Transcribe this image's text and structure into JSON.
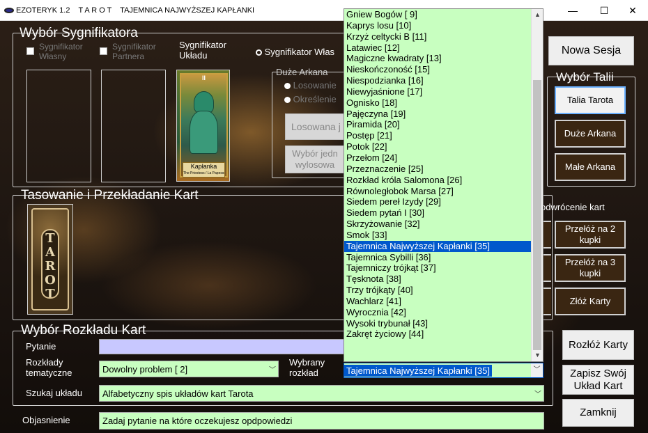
{
  "window": {
    "app_title": "EZOTERYK 1.2    T A R O T    TAJEMNICA NAJWYŻSZEJ KAPŁANKI",
    "minimize": "—",
    "maximize": "☐",
    "close": "✕"
  },
  "signif": {
    "title": "Wybór Sygnifikatora",
    "own_label": "Sygnifikator Własny",
    "partner_label": "Sygnifikator Partnera",
    "layout_label": "Sygnifikator Układu",
    "own_radio_label": "Sygnifikator Włas",
    "major_group": "Duże Arkana",
    "radio1_label": "Losowanie",
    "radio2_label": "Określenie",
    "random_btn": "Losowana j",
    "pick_btn": "Wybór jedn wylosowa",
    "card_caption_top": "II",
    "card_caption_name": "Kapłanka",
    "card_caption_sub": "The Priestess / La Papesse"
  },
  "shuffle": {
    "title": "Tasowanie i Przekładanie Kart",
    "deck_label": "TAROT",
    "reverse_label": "odwrócenie kart",
    "btn_cut2": "Przełóż na 2 kupki",
    "btn_cut3": "Przełóż na 3 kupki",
    "btn_join": "Złóż Karty"
  },
  "right": {
    "new_session": "Nowa Sesja",
    "deck_title": "Wybór Talii",
    "deck_tarot": "Talia Tarota",
    "deck_major": "Duże Arkana",
    "deck_minor": "Małe Arkana",
    "spread_btn": "Rozłóż Karty",
    "save_btn": "Zapisz Swój Układ Kart",
    "close_btn": "Zamknij"
  },
  "spread": {
    "title": "Wybór Rozkładu Kart",
    "question_label": "Pytanie",
    "question_value": "",
    "thematic_label": "Rozkłady tematyczne",
    "thematic_value": "Dowolny problem [ 2]",
    "chosen_label": "Wybrany rozkład",
    "chosen_value": "Tajemnica Najwyższej Kapłanki [35]",
    "search_label": "Szukaj układu",
    "search_value": "Alfabetyczny spis układów kart Tarota",
    "explain_label": "Objasnienie",
    "explain_value": "Zadaj pytanie na które oczekujesz opdpowiedzi"
  },
  "dropdown": {
    "selected_index": 23,
    "items": [
      "Gniew Bogów [ 9]",
      "Kaprys losu [10]",
      "Krzyż celtycki B [11]",
      "Latawiec [12]",
      "Magiczne kwadraty [13]",
      "Nieskończoność [15]",
      "Niespodzianka [16]",
      "Niewyjaśnione [17]",
      "Ognisko [18]",
      "Pajęczyna [19]",
      "Piramida [20]",
      "Postęp [21]",
      "Potok [22]",
      "Przełom [24]",
      "Przeznaczenie [25]",
      "Rozkład króla Salomona [26]",
      "Równoległobok Marsa [27]",
      "Siedem pereł Izydy [29]",
      "Siedem pytań I [30]",
      "Skrzyżowanie [32]",
      "Smok [33]",
      "Tajemnica Najwyższej Kapłanki [35]",
      "Tajemnica Sybilli [36]",
      "Tajemniczy trójkąt [37]",
      "Tęsknota [38]",
      "Trzy trójkąty [40]",
      "Wachlarz [41]",
      "Wyrocznia [42]",
      "Wysoki trybunał [43]",
      "Zakręt życiowy [44]"
    ]
  }
}
